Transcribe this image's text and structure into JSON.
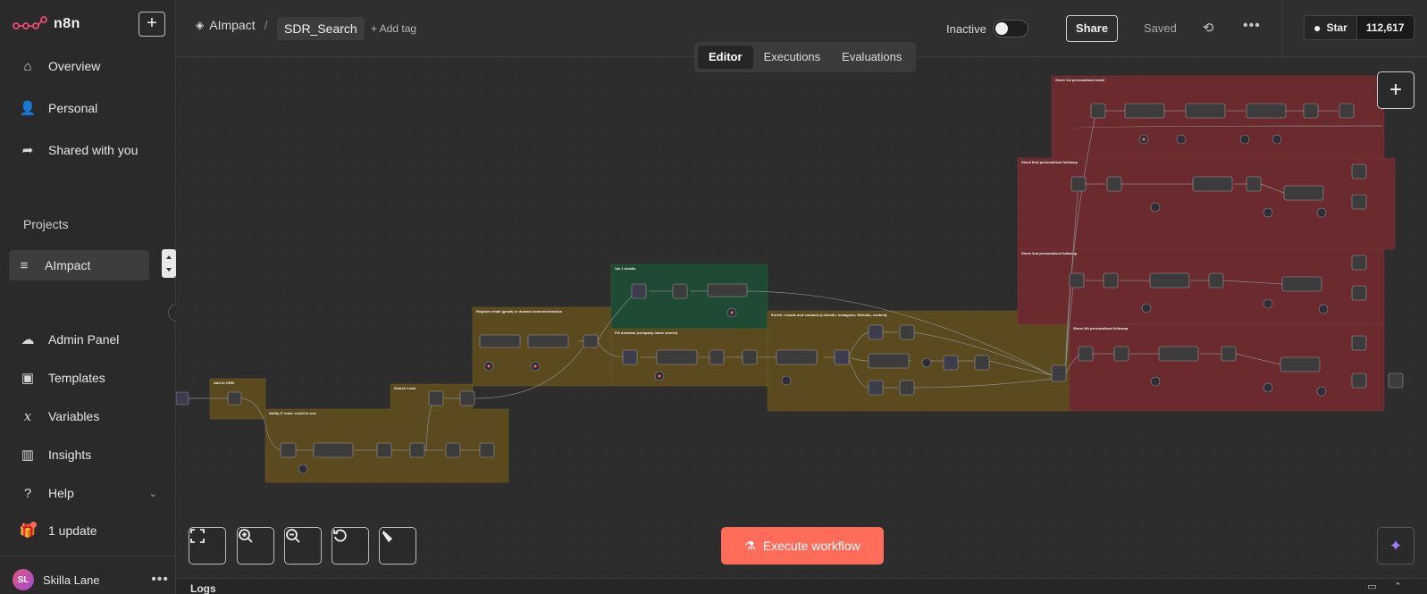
{
  "app": {
    "name": "n8n"
  },
  "sidebar": {
    "new_button": "+",
    "items": [
      {
        "label": "Overview",
        "icon": "home-icon"
      },
      {
        "label": "Personal",
        "icon": "user-icon"
      },
      {
        "label": "Shared with you",
        "icon": "share-icon"
      }
    ],
    "projects_label": "Projects",
    "project": {
      "label": "AImpact",
      "icon": "layers-icon"
    },
    "bottom_items": [
      {
        "label": "Admin Panel",
        "icon": "cloud-icon"
      },
      {
        "label": "Templates",
        "icon": "box-icon"
      },
      {
        "label": "Variables",
        "icon": "variable-icon"
      },
      {
        "label": "Insights",
        "icon": "chart-icon"
      },
      {
        "label": "Help",
        "icon": "question-icon"
      },
      {
        "label": "1 update",
        "icon": "gift-icon"
      }
    ],
    "user": {
      "initials": "SL",
      "name": "Skilla Lane",
      "more": "•••"
    }
  },
  "header": {
    "project": "AImpact",
    "separator": "/",
    "workflow_name": "SDR_Search",
    "add_tag": "+ Add tag",
    "status": "Inactive",
    "share": "Share",
    "saved": "Saved",
    "more": "•••",
    "github": {
      "star_label": "Star",
      "count": "112,617"
    }
  },
  "tabs": [
    {
      "label": "Editor",
      "active": true
    },
    {
      "label": "Executions",
      "active": false
    },
    {
      "label": "Evaluations",
      "active": false
    }
  ],
  "canvas": {
    "execute_button": "Execute workflow",
    "sticky_notes": [
      {
        "title": "Add to CRM",
        "color": "#5a4a1e"
      },
      {
        "title": "Notify IT team: result to one",
        "color": "#5a4a1e"
      },
      {
        "title": "Search Load",
        "color": "#5a4a1e"
      },
      {
        "title": "Register email (gmail) or domain search/extraction",
        "color": "#5a4a1e"
      },
      {
        "title": "Var 1 details",
        "color": "#1f4a33"
      },
      {
        "title": "Fill domains (company name search)",
        "color": "#5a4a1e"
      },
      {
        "title": "Enrich: results and contacts (Linkedin, Instagram, Website, content)",
        "color": "#5a4a1e"
      },
      {
        "title": "Sheet 1st personalised email",
        "color": "#6b2a2e"
      },
      {
        "title": "Sheet first personalised followup",
        "color": "#6b2a2e"
      },
      {
        "title": "Sheet 2nd personalised followup",
        "color": "#6b2a2e"
      },
      {
        "title": "Sheet 4th personalised followup",
        "color": "#6b2a2e"
      }
    ]
  },
  "logs": {
    "label": "Logs"
  },
  "colors": {
    "accent": "#ff6d5a",
    "brand": "#ea4b71",
    "ai": "#9d7bff"
  }
}
